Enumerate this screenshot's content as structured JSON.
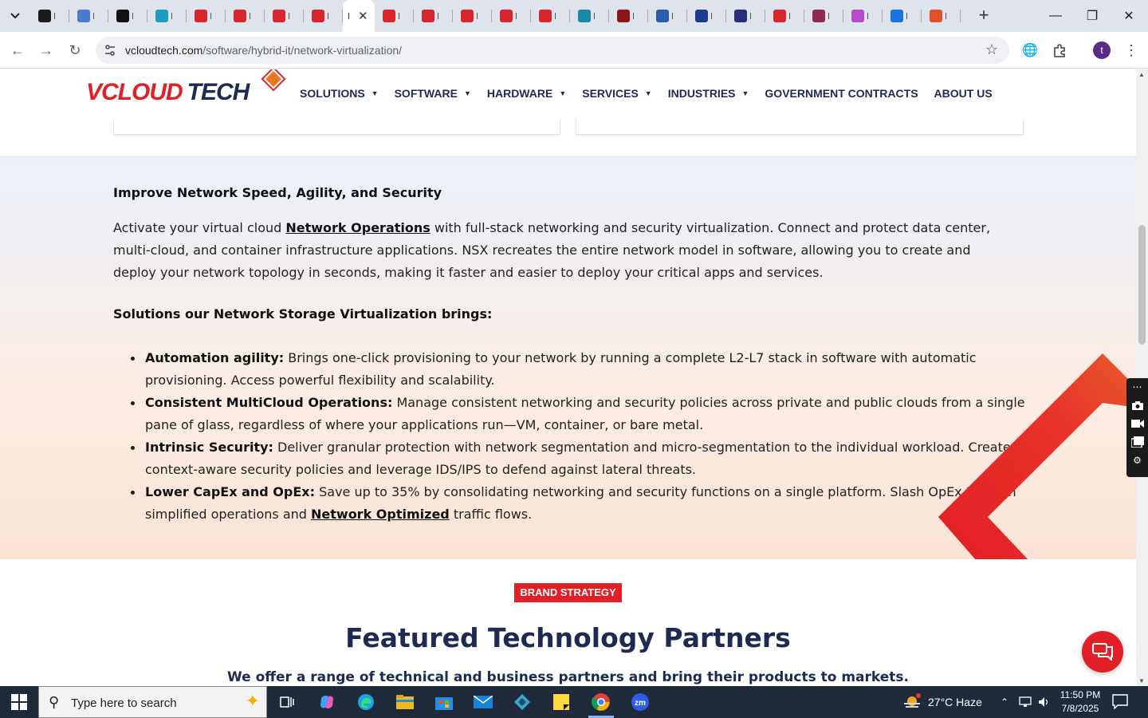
{
  "browser": {
    "tabs": [
      {
        "initial": "S",
        "color": "#1b1b1b"
      },
      {
        "initial": "F",
        "color": "#4a7bd0"
      },
      {
        "initial": "F",
        "color": "#111111"
      },
      {
        "initial": "T",
        "color": "#1f9bbd"
      },
      {
        "initial": "H",
        "color": "#d7262d"
      },
      {
        "initial": "S",
        "color": "#d7262d"
      },
      {
        "initial": "S",
        "color": "#d7262d"
      },
      {
        "initial": "L",
        "color": "#d7262d"
      },
      {
        "initial": "",
        "color": "#ffffff"
      },
      {
        "initial": "C",
        "color": "#d7262d"
      },
      {
        "initial": "C",
        "color": "#d7262d"
      },
      {
        "initial": "C",
        "color": "#d7262d"
      },
      {
        "initial": "I",
        "color": "#d7262d"
      },
      {
        "initial": "I",
        "color": "#d7262d"
      },
      {
        "initial": "C",
        "color": "#188aa7"
      },
      {
        "initial": "I",
        "color": "#8b1616"
      },
      {
        "initial": "E",
        "color": "#2a5ea8"
      },
      {
        "initial": "S",
        "color": "#1d3c8f"
      },
      {
        "initial": "C",
        "color": "#26307a"
      },
      {
        "initial": "I",
        "color": "#d7262d"
      },
      {
        "initial": "A",
        "color": "#8e2c4f"
      },
      {
        "initial": "S",
        "color": "#b44fc7"
      },
      {
        "initial": "V",
        "color": "#1a74e0"
      },
      {
        "initial": "C",
        "color": "#e0502b"
      }
    ],
    "url_host": "vcloudtech.com",
    "url_path": "/software/hybrid-it/network-virtualization/",
    "profile_initial": "t"
  },
  "site": {
    "logo_v": "V",
    "logo_cloud": "CLOUD",
    "logo_tech": "TECH",
    "nav": [
      {
        "label": "SOLUTIONS",
        "dropdown": true
      },
      {
        "label": "SOFTWARE",
        "dropdown": true
      },
      {
        "label": "HARDWARE",
        "dropdown": true
      },
      {
        "label": "SERVICES",
        "dropdown": true
      },
      {
        "label": "INDUSTRIES",
        "dropdown": true
      },
      {
        "label": "GOVERNMENT CONTRACTS",
        "dropdown": false
      },
      {
        "label": "ABOUT US",
        "dropdown": false
      }
    ]
  },
  "section": {
    "heading": "Improve Network Speed, Agility, and Security",
    "para_pre": " Activate your virtual cloud ",
    "para_link": "Network Operations",
    "para_post": " with full-stack networking and security virtualization. Connect and protect data center, multi-cloud, and container infrastructure applications. NSX recreates the entire network model in software, allowing you to create and deploy your network topology in seconds, making it faster and easier to deploy your critical apps and services.",
    "subheading": "Solutions our Network Storage Virtualization brings:",
    "bullets": [
      {
        "title": "Automation agility:",
        "text": " Brings one-click provisioning to your network by running a complete L2-L7 stack in software with automatic provisioning. Access powerful flexibility and scalability."
      },
      {
        "title": "Consistent MultiCloud Operations:",
        "text": " Manage consistent networking and security policies across private and public clouds from a single pane of glass, regardless of where your applications run—VM, container, or bare metal."
      },
      {
        "title": "Intrinsic Security:",
        "text": " Deliver granular protection with network segmentation and micro-segmentation to the individual workload. Create context-aware security policies and leverage IDS/IPS to defend against lateral threats."
      },
      {
        "title": "Lower CapEx and OpEx:",
        "text": " Save up to 35% by consolidating networking and security functions on a single platform. Slash OpEx through simplified operations and ",
        "link": "Network Optimized",
        "tail": " traffic flows."
      }
    ]
  },
  "partners": {
    "badge": "BRAND STRATEGY",
    "heading": "Featured Technology Partners",
    "subheading": "We offer a range of technical and business partners and bring their products to markets."
  },
  "taskbar": {
    "search_placeholder": "Type here to search",
    "weather": "27°C  Haze",
    "weather_badge": "1",
    "time": "11:50 PM",
    "date": "7/8/2025"
  },
  "colors": {
    "brand_red": "#e21f26",
    "brand_navy": "#1d2b52"
  }
}
